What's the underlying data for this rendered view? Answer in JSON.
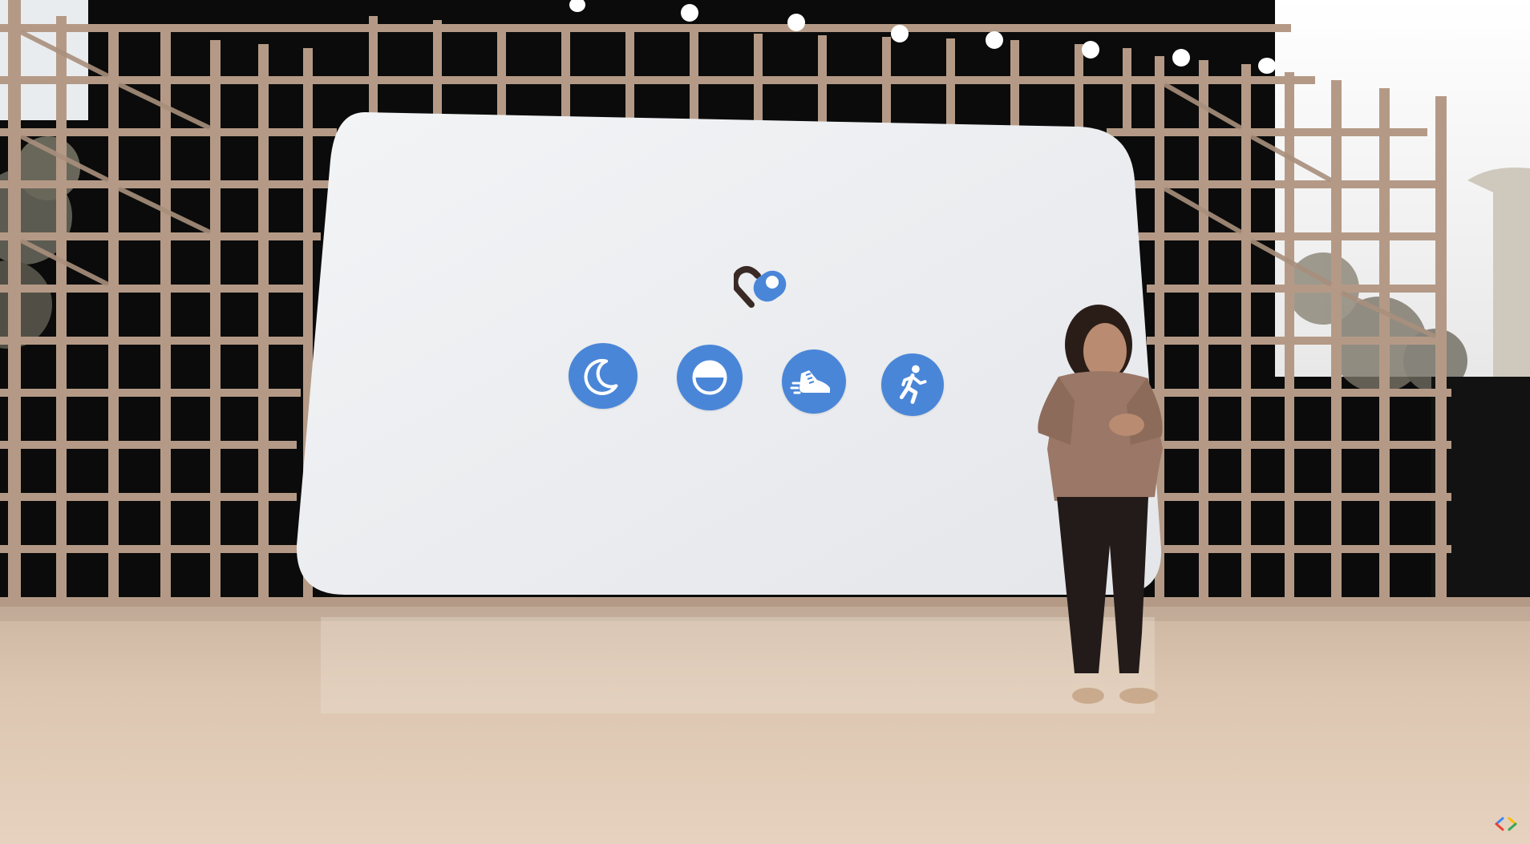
{
  "scene": {
    "description_colors": {
      "screen": "#e9eaec",
      "icon_blue": "#4a86d8",
      "truss": "#b89e8b",
      "floor": "#d8c2ad",
      "backdrop": "#0b0b0b"
    }
  },
  "screen": {
    "logo_icon": "health-connect-logo-icon",
    "icons": [
      {
        "name": "sleep-moon-icon"
      },
      {
        "name": "oxygen-half-circle-icon"
      },
      {
        "name": "shoe-steps-icon"
      },
      {
        "name": "running-person-icon"
      }
    ]
  },
  "watermark_icon": "google-io-logo-icon"
}
